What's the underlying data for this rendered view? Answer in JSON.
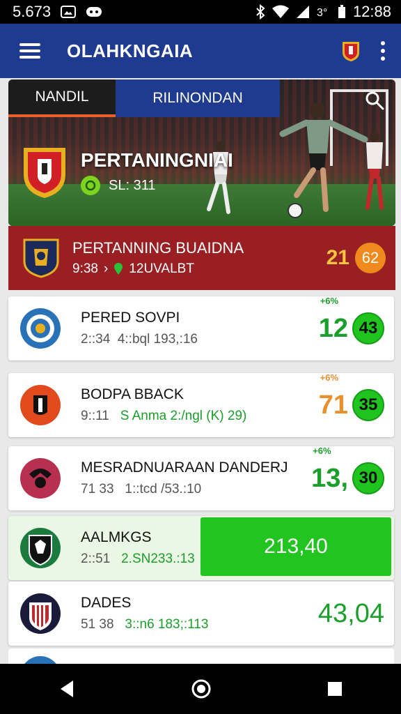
{
  "status_bar": {
    "left_text": "5.673",
    "time": "12:88"
  },
  "app": {
    "title": "OLAHKNGAIA"
  },
  "tabs": [
    {
      "label": "NANDIL",
      "active": true
    },
    {
      "label": "RILINONDAN",
      "active": false
    }
  ],
  "hero": {
    "title": "PERTANINGNIAI",
    "subtitle": "SL: 311"
  },
  "featured": {
    "name": "PERTANNING BUAIDNA",
    "time": "9:38",
    "separator": "›",
    "detail": "12UVALBT",
    "score": "21",
    "badge": "62"
  },
  "matches": [
    {
      "name": "PERED SOVPI",
      "time": "2::34",
      "detail": "4::bql 193,:16",
      "detail_highlight": false,
      "odds": "+6%",
      "odds_color": "#1b9e2b",
      "value": "12",
      "value_color": "#1b9e2b",
      "badge": "43",
      "logo_color": "#2a72b8"
    },
    {
      "name": "BODPA BBACK",
      "time": "9::11",
      "detail": "S Anma 2:/ngl (K) 29)",
      "detail_highlight": true,
      "odds": "+6%",
      "odds_color": "#e8902c",
      "value": "71",
      "value_color": "#e8902c",
      "badge": "35",
      "logo_color": "#e04a1c"
    },
    {
      "name": "MESRADNUARAAN DANDERJ",
      "time": "71 33",
      "detail": "1::tcd /53.:10",
      "detail_highlight": false,
      "odds": "+6%",
      "odds_color": "#1b9e2b",
      "value": "13,",
      "value_color": "#1b9e2b",
      "badge": "30",
      "logo_color": "#b83050"
    },
    {
      "name": "AALMKGS",
      "time": "2::51",
      "detail": "2.SN233.:13",
      "detail_highlight": true,
      "value": "213,40",
      "logo_color": "#1b7a3e"
    },
    {
      "name": "DADES",
      "time": "51 38",
      "detail": "3::n6 183;:113",
      "detail_highlight": true,
      "value": "43,04",
      "value_color": "#1b9e2b",
      "logo_color": "#c0282a"
    }
  ],
  "colors": {
    "appbar": "#1f3b8f",
    "featured": "#9a1f22",
    "green": "#22c51f",
    "orange": "#f08a1c"
  }
}
